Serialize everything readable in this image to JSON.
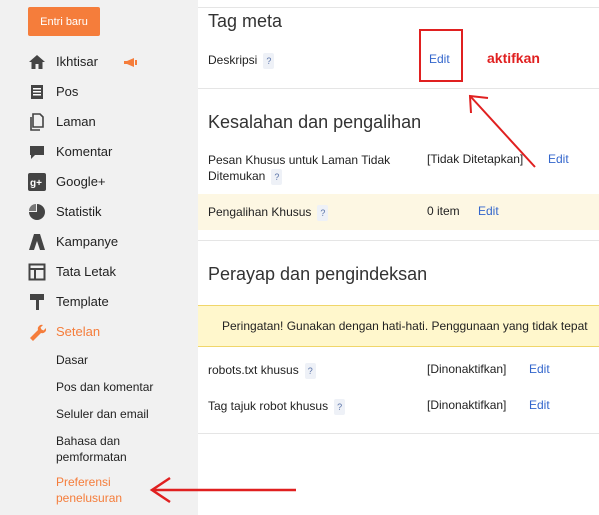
{
  "sidebar": {
    "new_post": "Entri baru",
    "items": [
      {
        "label": "Ikhtisar",
        "icon": "home-icon"
      },
      {
        "label": "Pos",
        "icon": "posts-icon"
      },
      {
        "label": "Laman",
        "icon": "pages-icon"
      },
      {
        "label": "Komentar",
        "icon": "comments-icon"
      },
      {
        "label": "Google+",
        "icon": "google-plus-icon"
      },
      {
        "label": "Statistik",
        "icon": "stats-icon"
      },
      {
        "label": "Kampanye",
        "icon": "campaigns-icon"
      },
      {
        "label": "Tata Letak",
        "icon": "layout-icon"
      },
      {
        "label": "Template",
        "icon": "template-icon"
      },
      {
        "label": "Setelan",
        "icon": "wrench-icon"
      }
    ],
    "subitems": [
      "Dasar",
      "Pos dan komentar",
      "Seluler dan email",
      "Bahasa dan pemformatan",
      "Preferensi penelusuran"
    ],
    "accent": "#f57d3b"
  },
  "main": {
    "meta": {
      "title": "Tag meta",
      "description_label": "Deskripsi",
      "edit": "Edit"
    },
    "errors": {
      "title": "Kesalahan dan pengalihan",
      "custom_404_label": "Pesan Khusus untuk Laman Tidak Ditemukan",
      "custom_404_value": "[Tidak Ditetapkan]",
      "custom_404_edit": "Edit",
      "redirects_label": "Pengalihan Khusus",
      "redirects_value": "0 item",
      "redirects_edit": "Edit"
    },
    "crawl": {
      "title": "Perayap dan pengindeksan",
      "warning": "Peringatan! Gunakan dengan hati-hati. Penggunaan yang tidak tepat",
      "robots_label": "robots.txt khusus",
      "robots_value": "[Dinonaktifkan]",
      "robots_edit": "Edit",
      "tags_label": "Tag tajuk robot khusus",
      "tags_value": "[Dinonaktifkan]",
      "tags_edit": "Edit"
    },
    "help_glyph": "?",
    "link_color": "#3366cc"
  },
  "annotation": {
    "text": "aktifkan",
    "color": "#e02020"
  }
}
